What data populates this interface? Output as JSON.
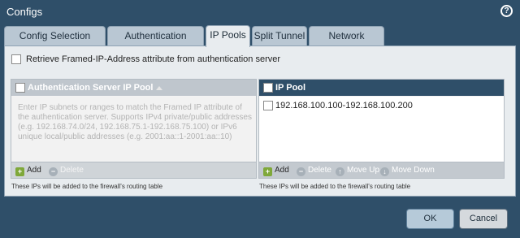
{
  "window": {
    "title": "Configs",
    "help_icon": "help-icon"
  },
  "tabs": [
    {
      "label": "Config Selection Criteria",
      "active": false
    },
    {
      "label": "Authentication Override",
      "active": false
    },
    {
      "label": "IP Pools",
      "active": true
    },
    {
      "label": "Split Tunnel",
      "active": false
    },
    {
      "label": "Network Services",
      "active": false
    }
  ],
  "retrieve_checkbox": {
    "label": "Retrieve Framed-IP-Address attribute from authentication server",
    "checked": false
  },
  "auth_pool": {
    "header": "Authentication Server IP Pool",
    "placeholder": "Enter IP subnets or ranges to match the Framed IP attribute of the authentication server. Supports IPv4 private/public addresses (e.g. 192.168.74.0/24, 192.168.75.1-192.168.75.100) or IPv6 unique local/public addresses (e.g. 2001:aa::1-2001:aa::10)",
    "add_label": "Add",
    "delete_label": "Delete",
    "note": "These IPs will be added to the firewall's routing table"
  },
  "ip_pool": {
    "header": "IP Pool",
    "rows": [
      "192.168.100.100-192.168.100.200"
    ],
    "add_label": "Add",
    "delete_label": "Delete",
    "move_up_label": "Move Up",
    "move_down_label": "Move Down",
    "note": "These IPs will be added to the firewall's routing table"
  },
  "buttons": {
    "ok": "OK",
    "cancel": "Cancel"
  }
}
